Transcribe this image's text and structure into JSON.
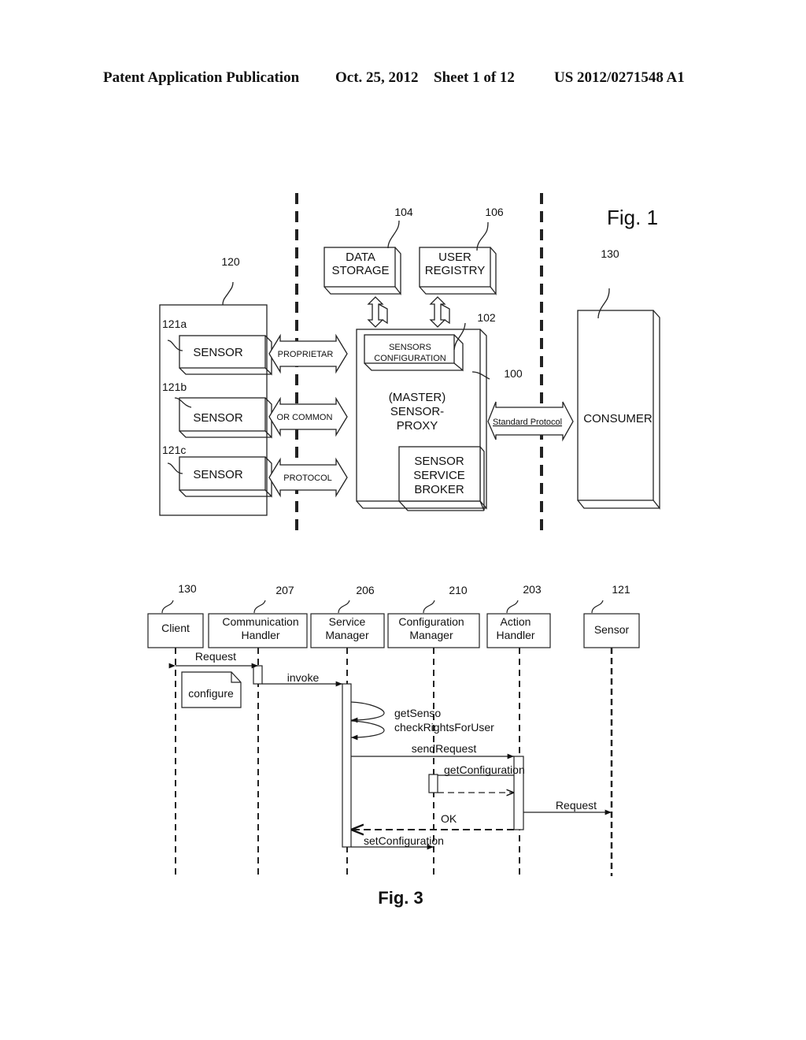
{
  "header": {
    "publication": "Patent Application Publication",
    "date": "Oct. 25, 2012",
    "sheet": "Sheet 1 of 12",
    "number": "US 2012/0271548 A1"
  },
  "fig1": {
    "title": "Fig. 1",
    "sensor_group": {
      "ref": "120"
    },
    "sensors": [
      {
        "ref": "121a",
        "label": "SENSOR",
        "protocol_label": "PROPRIETAR"
      },
      {
        "ref": "121b",
        "label": "SENSOR",
        "protocol_label": "OR COMMON"
      },
      {
        "ref": "121c",
        "label": "SENSOR",
        "protocol_label": "PROTOCOL"
      }
    ],
    "data_storage": {
      "ref": "104",
      "line1": "DATA",
      "line2": "STORAGE"
    },
    "user_registry": {
      "ref": "106",
      "line1": "USER",
      "line2": "REGISTRY"
    },
    "sensors_config": {
      "ref": "102",
      "line1": "SENSORS",
      "line2": "CONFIGURATION"
    },
    "proxy": {
      "ref": "100",
      "line1": "(MASTER)",
      "line2": "SENSOR-",
      "line3": "PROXY"
    },
    "broker": {
      "line1": "SENSOR",
      "line2": "SERVICE",
      "line3": "BROKER"
    },
    "standard_protocol": "Standard Protocol",
    "consumer": {
      "ref": "130",
      "label": "CONSUMER"
    }
  },
  "fig3": {
    "title": "Fig. 3",
    "lifelines": [
      {
        "ref": "130",
        "line1": "Client",
        "line2": ""
      },
      {
        "ref": "207",
        "line1": "Communication",
        "line2": "Handler"
      },
      {
        "ref": "206",
        "line1": "Service",
        "line2": "Manager"
      },
      {
        "ref": "210",
        "line1": "Configuration",
        "line2": "Manager"
      },
      {
        "ref": "203",
        "line1": "Action",
        "line2": "Handler"
      },
      {
        "ref": "121",
        "line1": "Sensor",
        "line2": ""
      }
    ],
    "note": "configure",
    "messages": {
      "request1": "Request",
      "invoke": "invoke",
      "get_sensor": "getSenso",
      "check_rights": "checkRightsForUser",
      "send_request": "sendRequest",
      "get_configuration": "getConfiguration",
      "request2": "Request",
      "ok": "OK",
      "set_configuration": "setConfiguration"
    }
  }
}
